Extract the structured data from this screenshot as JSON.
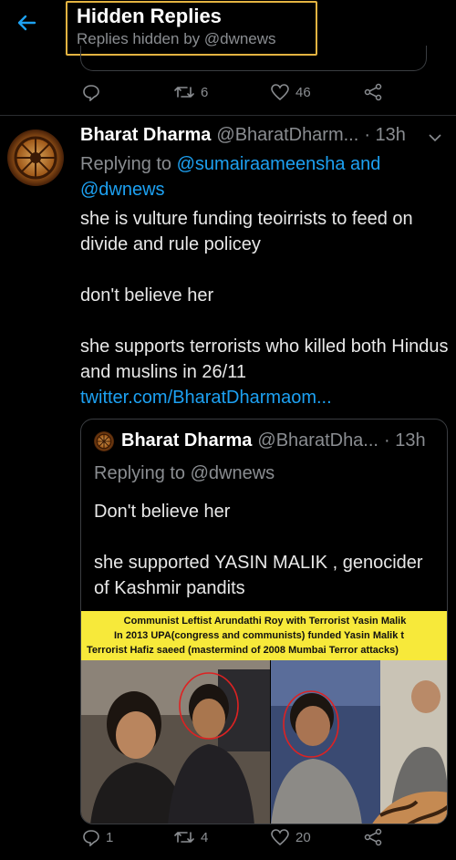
{
  "header": {
    "title": "Hidden Replies",
    "subtitle": "Replies hidden by @dwnews",
    "highlight_color": "#e3b341"
  },
  "previous_tweet_actions": {
    "retweets": "6",
    "likes": "46"
  },
  "tweet": {
    "name": "Bharat Dharma",
    "handle": "@BharatDharm...",
    "time": "· 13h",
    "replying_prefix": "Replying to ",
    "replying_mention1": "@sumairaameensha",
    "replying_and": " and",
    "replying_mention2": "@dwnews",
    "lines": [
      "she is vulture funding teoirrists to feed on divide and rule policey",
      "don't believe her",
      "she supports terrorists who killed both Hindus and muslins in 26/11"
    ],
    "link": "twitter.com/BharatDharmaom..."
  },
  "quoted_tweet": {
    "name": "Bharat Dharma",
    "handle": "@BharatDha...",
    "time": "· 13h",
    "replying": "Replying to @dwnews",
    "line1": "Don't believe her",
    "line2": "she supported YASIN MALIK , genocider of Kashmir pandits",
    "banner": {
      "line1": "Communist Leftist Arundathi Roy with Terrorist Yasin Malik",
      "line2": "In 2013 UPA(congress and communists) funded Yasin Malik t",
      "line3": "Terrorist Hafiz saeed (mastermind of 2008 Mumbai Terror attacks)",
      "color": "#f7e93a"
    }
  },
  "tweet_actions": {
    "replies": "1",
    "retweets": "4",
    "likes": "20"
  },
  "colors": {
    "accent": "#1da1f2",
    "muted": "#8a8d91",
    "background": "#000000"
  }
}
